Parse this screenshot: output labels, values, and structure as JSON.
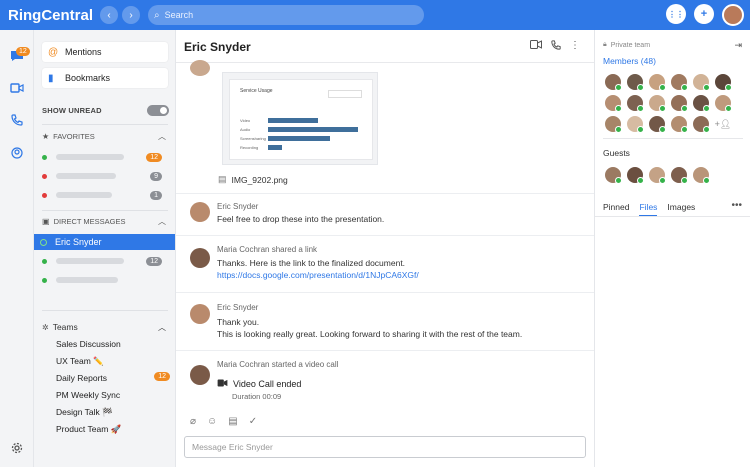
{
  "app": {
    "brand": "RingCentral"
  },
  "topbar": {
    "search_placeholder": "Search",
    "back": "‹",
    "forward": "›",
    "dialpad": "⋮⋮",
    "add": "+"
  },
  "rail": {
    "messages_badge": "12"
  },
  "sidebar": {
    "mentions": "Mentions",
    "bookmarks": "Bookmarks",
    "show_unread": "SHOW UNREAD",
    "favorites": {
      "label": "FAVORITES",
      "badges": [
        "12",
        "9",
        "1"
      ]
    },
    "direct_messages": {
      "label": "DIRECT MESSAGES",
      "active": "Eric Snyder",
      "badges": [
        "12"
      ]
    },
    "teams": {
      "label": "Teams",
      "items": [
        {
          "name": "Sales Discussion"
        },
        {
          "name": "UX Team ✏️"
        },
        {
          "name": "Daily Reports",
          "badge": "12"
        },
        {
          "name": "PM Weekly Sync"
        },
        {
          "name": "Design Talk 🏁"
        },
        {
          "name": "Product Team 🚀"
        }
      ]
    }
  },
  "chat": {
    "title": "Eric Snyder",
    "attachment": {
      "filename": "IMG_9202.png",
      "thumb_title": "Service Usage",
      "thumb_labels": [
        "Video",
        "Audio",
        "Screensharing",
        "Recording"
      ]
    },
    "messages": [
      {
        "author": "Eric Snyder",
        "lines": [
          "Feel free to drop these into the presentation."
        ]
      },
      {
        "author": "Maria Cochran shared  a link",
        "lines": [
          "Thanks. Here is the link to the finalized document."
        ],
        "link": "https://docs.google.com/presentation/d/1NJpCA6XGf/"
      },
      {
        "author": "Eric Snyder",
        "lines": [
          "Thank you.",
          "This is looking really great. Looking forward to sharing it with the rest of the team."
        ]
      },
      {
        "author": "Maria Cochran started a video call",
        "call_title": "Video Call ended",
        "duration": "Duration 00:09"
      }
    ],
    "composer_placeholder": "Message Eric Snyder"
  },
  "details": {
    "private_label": "Private team",
    "members_label": "Members (48)",
    "guests_label": "Guests",
    "tabs": [
      "Pinned",
      "Files",
      "Images"
    ],
    "active_tab": "Files",
    "more": "•••"
  },
  "colors": {
    "accent": "#2f78e6",
    "badge": "#f08b22",
    "online": "#35b24a"
  }
}
